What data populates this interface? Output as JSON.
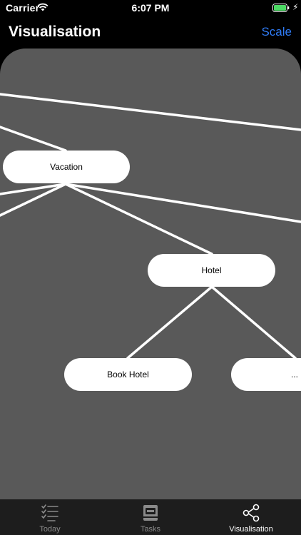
{
  "status_bar": {
    "carrier": "Carrier",
    "time": "6:07 PM"
  },
  "nav": {
    "title": "Visualisation",
    "scale_label": "Scale"
  },
  "graph": {
    "nodes": {
      "vacation": "Vacation",
      "hotel": "Hotel",
      "book_hotel": "Book Hotel",
      "more": "..."
    }
  },
  "tab_bar": {
    "tabs": [
      {
        "label": "Today",
        "icon": "checklist-icon"
      },
      {
        "label": "Tasks",
        "icon": "inbox-tray-icon"
      },
      {
        "label": "Visualisation",
        "icon": "share-graph-icon",
        "selected": true
      }
    ]
  },
  "colors": {
    "accent": "#2f7bf5",
    "canvas": "#595959",
    "tab_bar": "#1d1d1d"
  }
}
